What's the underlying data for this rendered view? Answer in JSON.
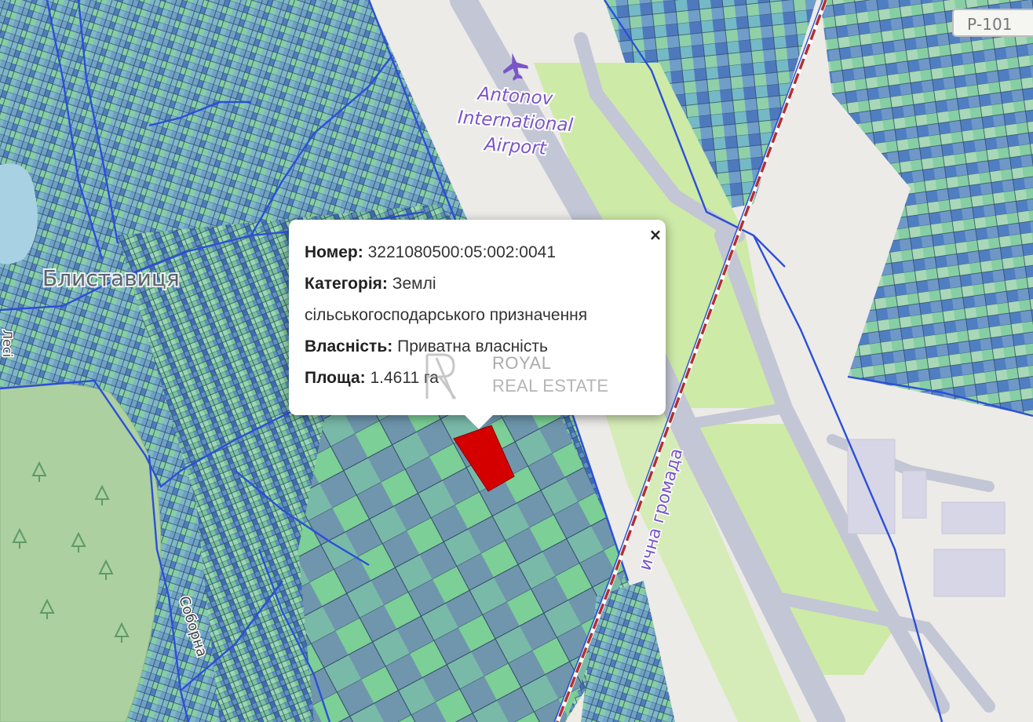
{
  "map": {
    "airport_label_lines": [
      "Antonov",
      "International",
      "Airport"
    ],
    "village_label": "Блиставиця",
    "road_label": "ична громада",
    "route_label": "Р-101",
    "street_label_left": "Соборна",
    "street_label_right": "Лесі",
    "selected_parcel_color": "#d40000",
    "colors": {
      "background": "#eeeae4",
      "runway": "#c5c9d4",
      "green_field": "#cdeaa7",
      "parcel_light": "#80ce9a",
      "parcel_mid": "#6fa7c4",
      "parcel_dark": "#3f6db5",
      "boundary": "#2c4fd8",
      "railway": "#b33030"
    },
    "icons": [
      "airport-icon",
      "tree-icon"
    ]
  },
  "popup": {
    "number_label": "Номер:",
    "number_value": "3221080500:05:002:0041",
    "category_label": "Категорія:",
    "category_value_line1": "Землі",
    "category_value_line2": "сільськогосподарського призначення",
    "ownership_label": "Власність:",
    "ownership_value": "Приватна власність",
    "area_label": "Площа:",
    "area_value": "1.4611 га",
    "close_symbol": "×"
  },
  "watermark": {
    "line1": "ROYAL",
    "line2": "REAL ESTATE"
  }
}
